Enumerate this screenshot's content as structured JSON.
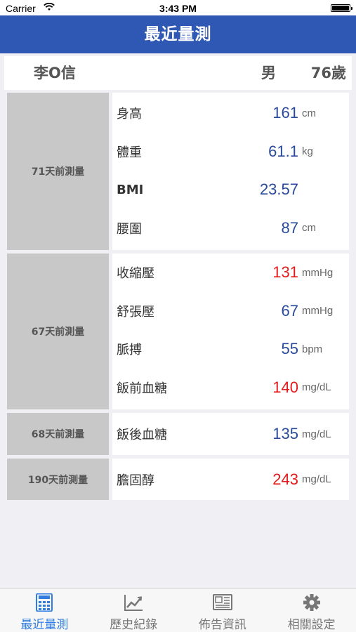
{
  "status_bar": {
    "carrier": "Carrier",
    "time": "3:43 PM"
  },
  "nav": {
    "title": "最近量測"
  },
  "patient": {
    "name": "李O信",
    "gender": "男",
    "age": "76歲"
  },
  "groups": [
    {
      "label": "71天前測量",
      "items": [
        {
          "label": "身高",
          "value": "161",
          "unit": "cm",
          "value_color": "blue"
        },
        {
          "label": "體重",
          "value": "61.1",
          "unit": "kg",
          "value_color": "blue"
        },
        {
          "label": "BMI",
          "value": "23.57",
          "unit": "",
          "value_color": "blue"
        },
        {
          "label": "腰圍",
          "value": "87",
          "unit": "cm",
          "value_color": "blue"
        }
      ]
    },
    {
      "label": "67天前測量",
      "items": [
        {
          "label": "收縮壓",
          "value": "131",
          "unit": "mmHg",
          "value_color": "red"
        },
        {
          "label": "舒張壓",
          "value": "67",
          "unit": "mmHg",
          "value_color": "blue"
        },
        {
          "label": "脈搏",
          "value": "55",
          "unit": "bpm",
          "value_color": "blue"
        },
        {
          "label": "飯前血糖",
          "value": "140",
          "unit": "mg/dL",
          "value_color": "red"
        }
      ]
    },
    {
      "label": "68天前測量",
      "items": [
        {
          "label": "飯後血糖",
          "value": "135",
          "unit": "mg/dL",
          "value_color": "blue"
        }
      ]
    },
    {
      "label": "190天前測量",
      "items": [
        {
          "label": "膽固醇",
          "value": "243",
          "unit": "mg/dL",
          "value_color": "red"
        }
      ]
    }
  ],
  "tabs": [
    {
      "label": "最近量測",
      "icon": "calculator-icon",
      "active": true
    },
    {
      "label": "歷史紀錄",
      "icon": "chart-icon",
      "active": false
    },
    {
      "label": "佈告資訊",
      "icon": "newspaper-icon",
      "active": false
    },
    {
      "label": "相關設定",
      "icon": "gear-icon",
      "active": false
    }
  ],
  "colors": {
    "nav": "#2f58b5",
    "value_blue": "#2a4a9a",
    "value_red": "#e51b1b",
    "tab_active": "#2f7de1",
    "tab_inactive": "#777777"
  }
}
